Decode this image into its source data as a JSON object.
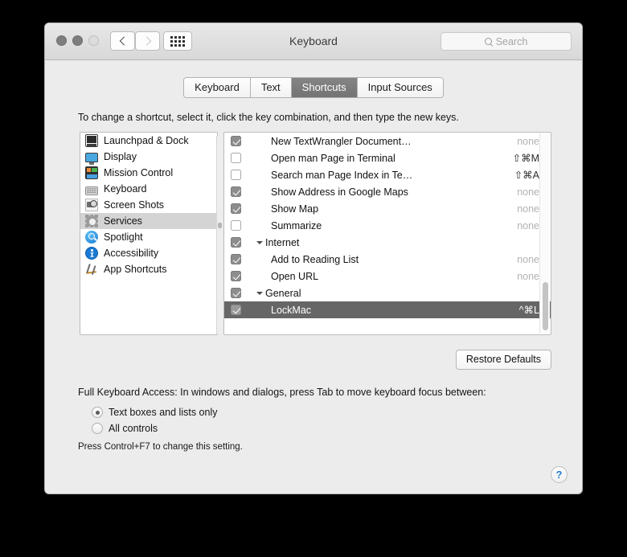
{
  "window": {
    "title": "Keyboard",
    "traffic_lights": [
      "close",
      "minimize",
      "zoom"
    ],
    "nav": {
      "back": "‹",
      "forward": "›",
      "show_all": "grid"
    },
    "search": {
      "placeholder": "Search",
      "value": ""
    }
  },
  "tabs": [
    {
      "label": "Keyboard",
      "active": false
    },
    {
      "label": "Text",
      "active": false
    },
    {
      "label": "Shortcuts",
      "active": true
    },
    {
      "label": "Input Sources",
      "active": false
    }
  ],
  "instruction": "To change a shortcut, select it, click the key combination, and then type the new keys.",
  "sidebar": {
    "items": [
      {
        "label": "Launchpad & Dock",
        "icon": "dock-icon",
        "selected": false
      },
      {
        "label": "Display",
        "icon": "display-icon",
        "selected": false
      },
      {
        "label": "Mission Control",
        "icon": "mission-control-icon",
        "selected": false
      },
      {
        "label": "Keyboard",
        "icon": "keyboard-icon",
        "selected": false
      },
      {
        "label": "Screen Shots",
        "icon": "screenshot-icon",
        "selected": false
      },
      {
        "label": "Services",
        "icon": "gear-icon",
        "selected": true
      },
      {
        "label": "Spotlight",
        "icon": "spotlight-icon",
        "selected": false
      },
      {
        "label": "Accessibility",
        "icon": "accessibility-icon",
        "selected": false
      },
      {
        "label": "App Shortcuts",
        "icon": "app-shortcuts-icon",
        "selected": false
      }
    ]
  },
  "shortcut_list": {
    "rows": [
      {
        "label": "New TextWrangler Document…",
        "checked": true,
        "group": false,
        "indent": true,
        "key": "none",
        "assigned": false,
        "selected": false
      },
      {
        "label": "Open man Page in Terminal",
        "checked": false,
        "group": false,
        "indent": true,
        "key": "⇧⌘M",
        "assigned": true,
        "selected": false
      },
      {
        "label": "Search man Page Index in Te…",
        "checked": false,
        "group": false,
        "indent": true,
        "key": "⇧⌘A",
        "assigned": true,
        "selected": false
      },
      {
        "label": "Show Address in Google Maps",
        "checked": true,
        "group": false,
        "indent": true,
        "key": "none",
        "assigned": false,
        "selected": false
      },
      {
        "label": "Show Map",
        "checked": true,
        "group": false,
        "indent": true,
        "key": "none",
        "assigned": false,
        "selected": false
      },
      {
        "label": "Summarize",
        "checked": false,
        "group": false,
        "indent": true,
        "key": "none",
        "assigned": false,
        "selected": false
      },
      {
        "label": "Internet",
        "checked": true,
        "group": true,
        "indent": false,
        "key": "",
        "assigned": false,
        "selected": false
      },
      {
        "label": "Add to Reading List",
        "checked": true,
        "group": false,
        "indent": true,
        "key": "none",
        "assigned": false,
        "selected": false
      },
      {
        "label": "Open URL",
        "checked": true,
        "group": false,
        "indent": true,
        "key": "none",
        "assigned": false,
        "selected": false
      },
      {
        "label": "General",
        "checked": true,
        "group": true,
        "indent": false,
        "key": "",
        "assigned": false,
        "selected": false
      },
      {
        "label": "LockMac",
        "checked": true,
        "group": false,
        "indent": true,
        "key": "^⌘L",
        "assigned": true,
        "selected": true
      }
    ]
  },
  "restore_button": "Restore Defaults",
  "full_keyboard_access": {
    "label": "Full Keyboard Access: In windows and dialogs, press Tab to move keyboard focus between:",
    "options": [
      {
        "label": "Text boxes and lists only",
        "selected": true
      },
      {
        "label": "All controls",
        "selected": false
      }
    ],
    "hint": "Press Control+F7 to change this setting."
  },
  "help_button": "?",
  "colors": {
    "selected_row": "#666666",
    "selected_tab": "#7a7a7a",
    "sidebar_selection": "#d4d4d4",
    "accent_help": "#2a7fd4",
    "window_background": "#ececec"
  }
}
